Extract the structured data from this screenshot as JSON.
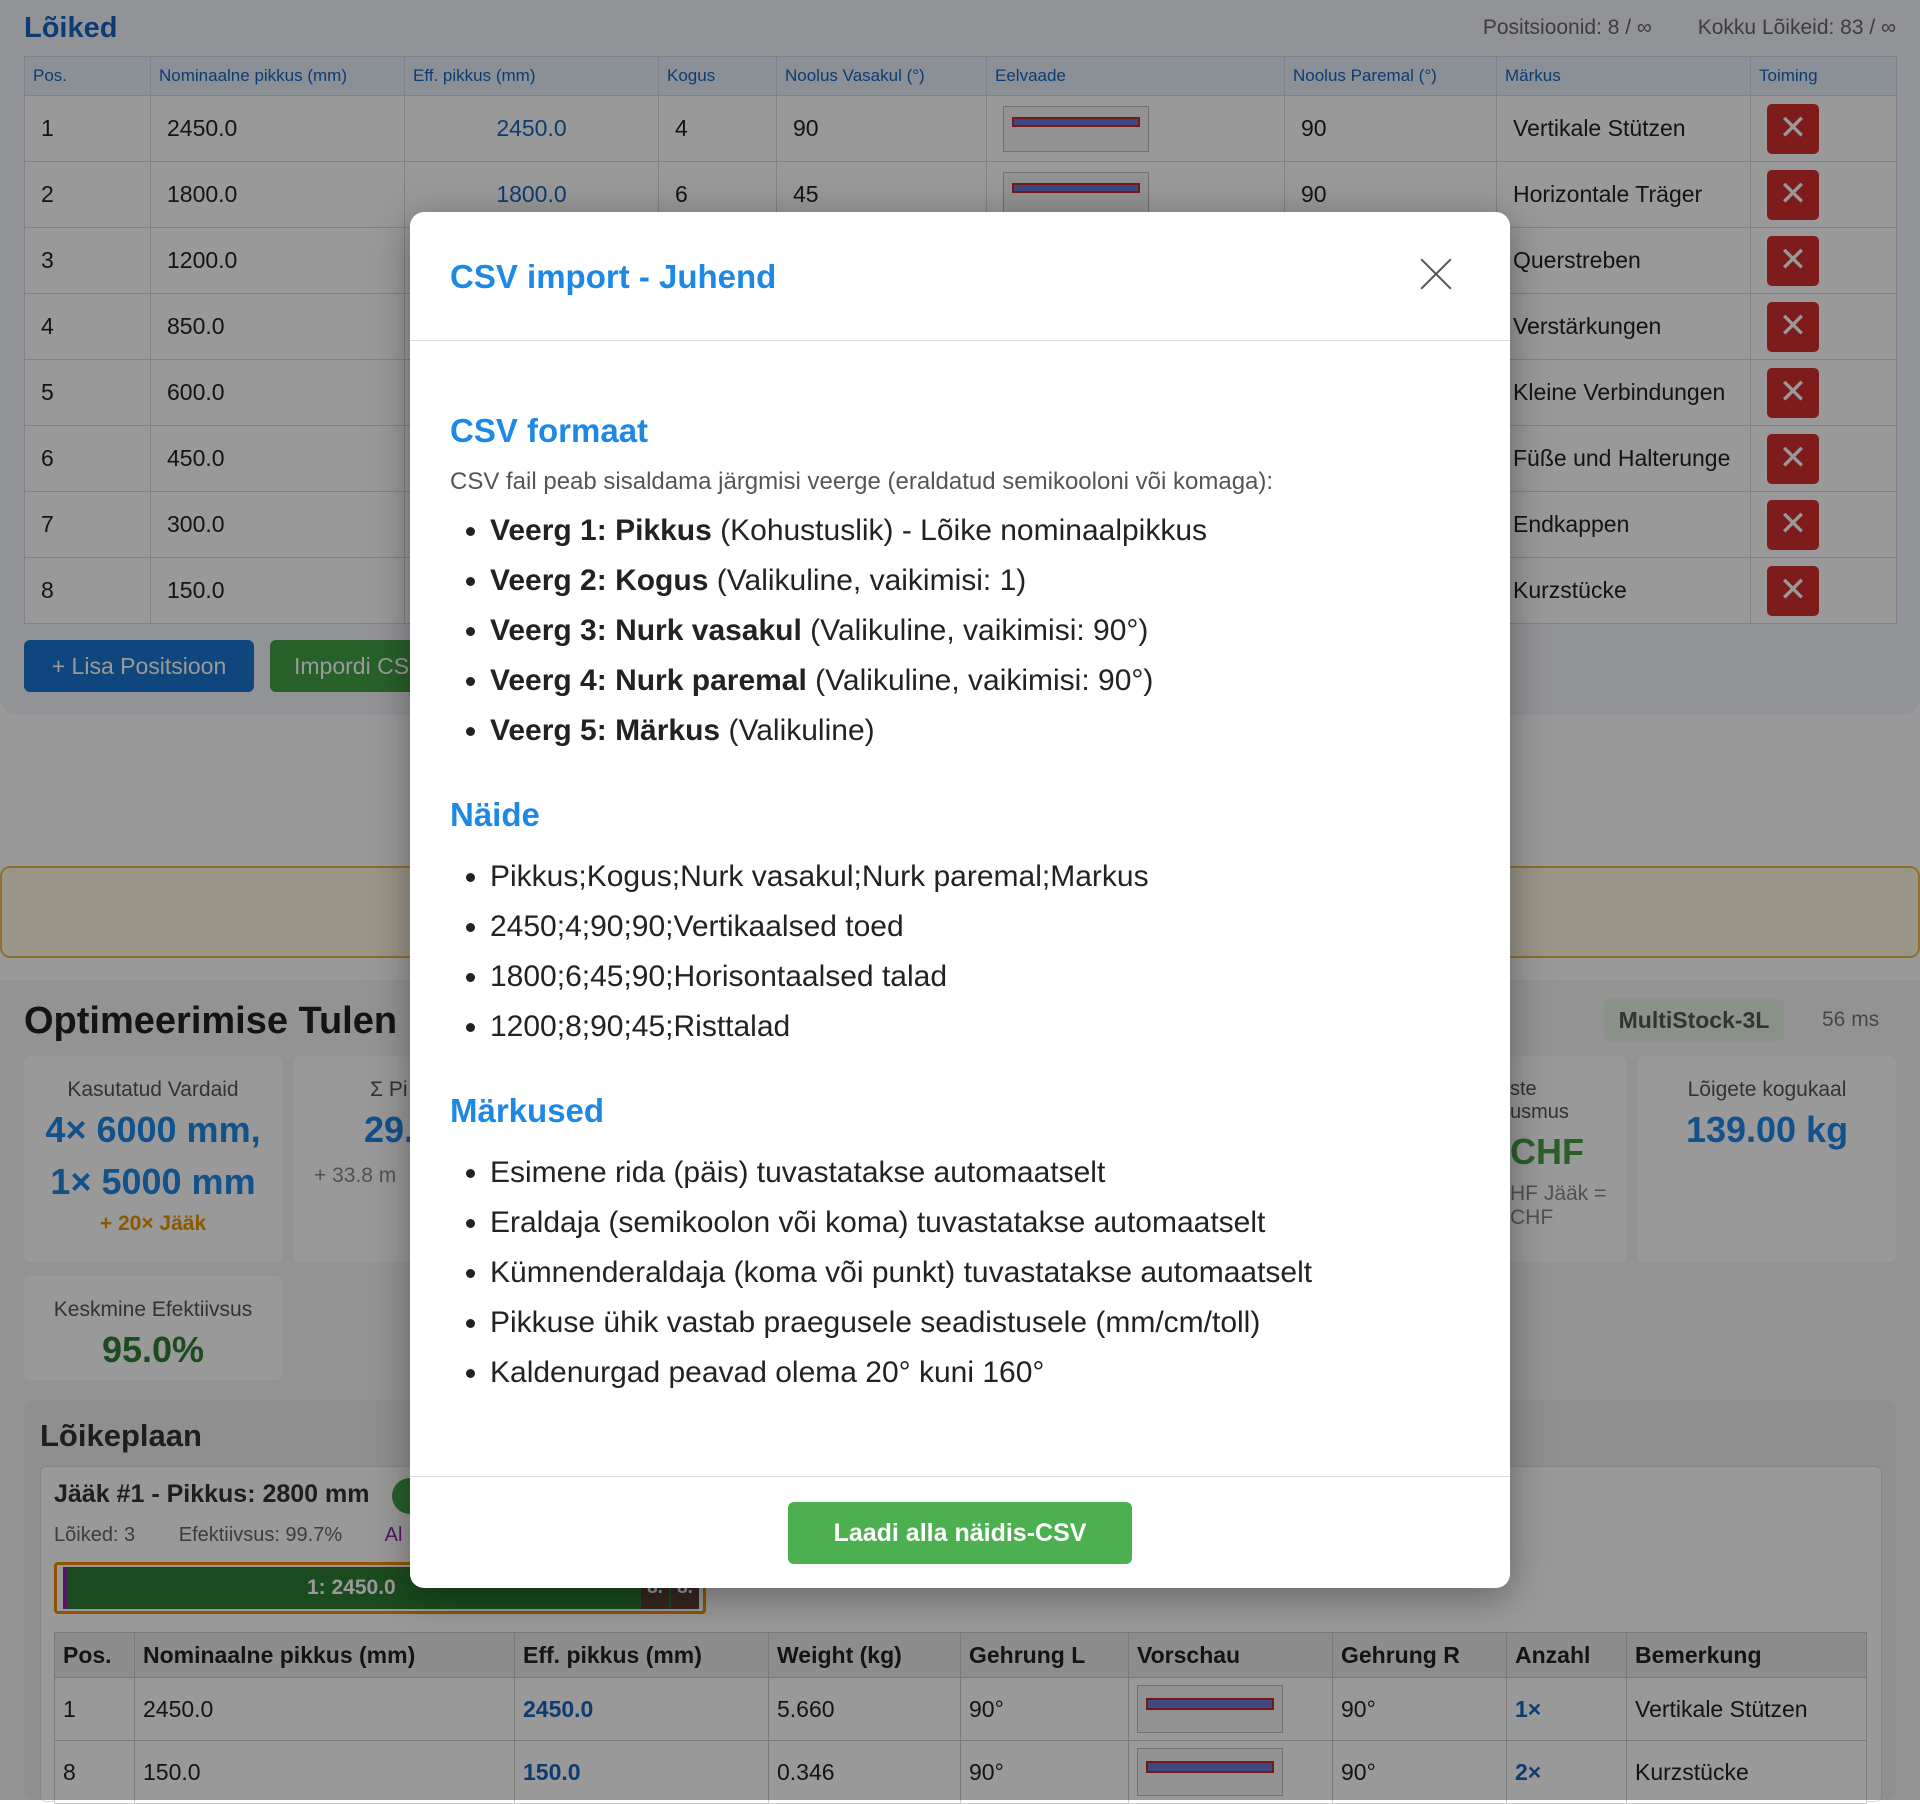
{
  "cuts": {
    "title": "Lõiked",
    "positions_stat": "Positsioonid: 8 / ∞",
    "total_stat": "Kokku Lõikeid: 83 / ∞",
    "columns": [
      "Pos.",
      "Nominaalne pikkus (mm)",
      "Eff. pikkus (mm)",
      "Kogus",
      "Noolus Vasakul (°)",
      "Eelvaade",
      "Noolus Paremal (°)",
      "Märkus",
      "Toiming"
    ],
    "rows": [
      {
        "pos": "1",
        "nominal": "2450.0",
        "eff": "2450.0",
        "qty": "4",
        "left": "90",
        "right": "90",
        "note": "Vertikale Stützen"
      },
      {
        "pos": "2",
        "nominal": "1800.0",
        "eff": "1800.0",
        "qty": "6",
        "left": "45",
        "right": "90",
        "note": "Horizontale Träger"
      },
      {
        "pos": "3",
        "nominal": "1200.0",
        "eff": "",
        "qty": "",
        "left": "",
        "right": "",
        "note": "Querstreben"
      },
      {
        "pos": "4",
        "nominal": "850.0",
        "eff": "",
        "qty": "",
        "left": "",
        "right": "",
        "note": "Verstärkungen"
      },
      {
        "pos": "5",
        "nominal": "600.0",
        "eff": "",
        "qty": "",
        "left": "",
        "right": "",
        "note": "Kleine Verbindungen"
      },
      {
        "pos": "6",
        "nominal": "450.0",
        "eff": "",
        "qty": "",
        "left": "",
        "right": "",
        "note": "Füße und Halterunge"
      },
      {
        "pos": "7",
        "nominal": "300.0",
        "eff": "",
        "qty": "",
        "left": "",
        "right": "",
        "note": "Endkappen"
      },
      {
        "pos": "8",
        "nominal": "150.0",
        "eff": "",
        "qty": "",
        "left": "",
        "right": "",
        "note": "Kurzstücke"
      }
    ],
    "add_button": "+ Lisa Positsioon",
    "import_button": "Impordi CS",
    "delete_glyph": "✕"
  },
  "results": {
    "title": "Optimeerimise Tulen",
    "algorithm": "MultiStock-3L",
    "time": "56 ms",
    "cards": {
      "used_label": "Kasutatud Vardaid",
      "used_value_1": "4× 6000 mm,",
      "used_value_2": "1× 5000 mm",
      "used_sub": "+ 20× Jääk",
      "sum_label": "Σ Pi",
      "sum_value": "29.",
      "sum_sub": "+ 33.8 m",
      "cost_label_1": "ste",
      "cost_label_2": "usmus",
      "cost_value": "CHF",
      "cost_sub_1": "HF Jääk =",
      "cost_sub_2": "CHF",
      "weight_label": "Lõigete kogukaal",
      "weight_value": "139.00 kg",
      "eff_label": "Keskmine Efektiivsus",
      "eff_value": "95.0%"
    }
  },
  "plan": {
    "title": "Lõikeplaan",
    "remnant_title": "Jääk #1 - Pikkus: 2800 mm",
    "cuts_count": "Lõiked: 3",
    "efficiency": "Efektiivsus: 99.7%",
    "al_text": "Al",
    "segment_label": "1: 2450.0",
    "small_seg_1": "8.",
    "small_seg_2": "8.",
    "columns": [
      "Pos.",
      "Nominaalne pikkus (mm)",
      "Eff. pikkus (mm)",
      "Weight (kg)",
      "Gehrung L",
      "Vorschau",
      "Gehrung R",
      "Anzahl",
      "Bemerkung"
    ],
    "rows": [
      {
        "pos": "1",
        "nominal": "2450.0",
        "eff": "2450.0",
        "weight": "5.660",
        "gl": "90°",
        "gr": "90°",
        "qty": "1×",
        "note": "Vertikale Stützen"
      },
      {
        "pos": "8",
        "nominal": "150.0",
        "eff": "150.0",
        "weight": "0.346",
        "gl": "90°",
        "gr": "90°",
        "qty": "2×",
        "note": "Kurzstücke"
      }
    ]
  },
  "modal": {
    "title": "CSV import - Juhend",
    "format_title": "CSV formaat",
    "format_intro": "CSV fail peab sisaldama järgmisi veerge (eraldatud semikooloni või komaga):",
    "columns": [
      {
        "bold": "Veerg 1: Pikkus",
        "rest": " (Kohustuslik) - Lõike nominaalpikkus"
      },
      {
        "bold": "Veerg 2: Kogus",
        "rest": " (Valikuline, vaikimisi: 1)"
      },
      {
        "bold": "Veerg 3: Nurk vasakul",
        "rest": " (Valikuline, vaikimisi: 90°)"
      },
      {
        "bold": "Veerg 4: Nurk paremal",
        "rest": " (Valikuline, vaikimisi: 90°)"
      },
      {
        "bold": "Veerg 5: Märkus",
        "rest": " (Valikuline)"
      }
    ],
    "example_title": "Näide",
    "examples": [
      "Pikkus;Kogus;Nurk vasakul;Nurk paremal;Markus",
      "2450;4;90;90;Vertikaalsed toed",
      "1800;6;45;90;Horisontaalsed talad",
      "1200;8;90;45;Risttalad"
    ],
    "notes_title": "Märkused",
    "notes": [
      "Esimene rida (päis) tuvastatakse automaatselt",
      "Eraldaja (semikoolon või koma) tuvastatakse automaatselt",
      "Kümnenderaldaja (koma või punkt) tuvastatakse automaatselt",
      "Pikkuse ühik vastab praegusele seadistusele (mm/cm/toll)",
      "Kaldenurgad peavad olema 20° kuni 160°"
    ],
    "download_button": "Laadi alla näidis-CSV"
  }
}
